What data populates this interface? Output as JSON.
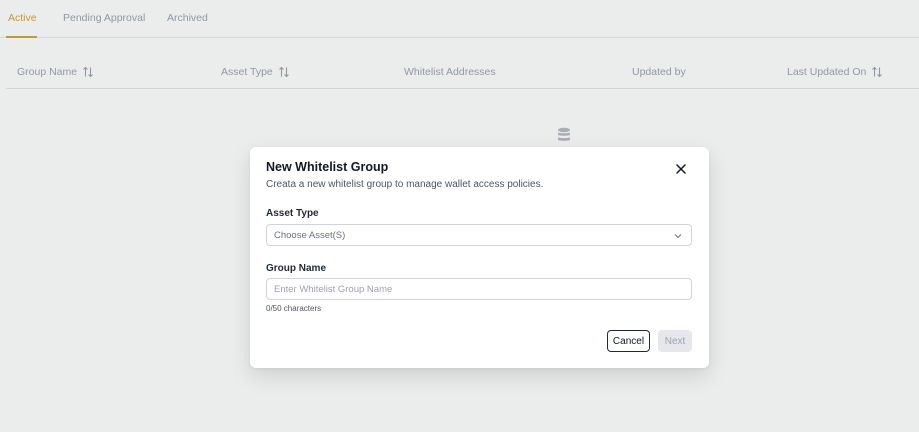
{
  "tabs": [
    {
      "label": "Active",
      "active": true
    },
    {
      "label": "Pending Approval",
      "active": false
    },
    {
      "label": "Archived",
      "active": false
    }
  ],
  "table": {
    "columns": [
      {
        "label": "Group Name",
        "sortable": true
      },
      {
        "label": "Asset Type",
        "sortable": true
      },
      {
        "label": "Whitelist Addresses",
        "sortable": false
      },
      {
        "label": "Updated by",
        "sortable": false
      },
      {
        "label": "Last Updated On",
        "sortable": true
      }
    ]
  },
  "icons": {
    "sort": "sort-arrows-icon",
    "empty": "database-icon",
    "close": "close-icon",
    "chevron": "chevron-down-icon"
  },
  "modal": {
    "title": "New Whitelist Group",
    "description": "Creata a new whitelist group to manage wallet access policies.",
    "asset_type": {
      "label": "Asset Type",
      "placeholder": "Choose Asset(S)"
    },
    "group_name": {
      "label": "Group Name",
      "placeholder": "Enter Whitelist Group Name",
      "value": "",
      "char_count": "0/50 characters"
    },
    "cancel_label": "Cancel",
    "next_label": "Next"
  },
  "colors": {
    "accent": "#d4a72c",
    "muted_text": "#9ca3af",
    "button_disabled_bg": "#e5e7eb",
    "overlay": "rgba(60,64,72,0.10)"
  }
}
